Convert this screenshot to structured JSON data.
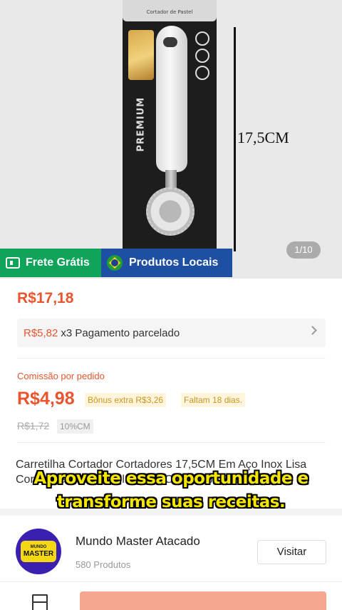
{
  "hero": {
    "package_label": "Cortador de Pastel",
    "brand_text": "PREMIUM",
    "dimension_label": "17,5CM",
    "pager": "1/10"
  },
  "badges": {
    "frete": "Frete Grátis",
    "local": "Produtos Locais"
  },
  "price": {
    "current": "R$17,18",
    "installment_amount": "R$5,82",
    "installment_text": "x3 Pagamento parcelado"
  },
  "commission": {
    "label": "Comissão por pedido",
    "value": "R$4,98",
    "bonus": "Bônus extra R$3,26",
    "remaining": "Faltam 18 dias.",
    "old_value": "R$1,72",
    "percent": "10%CM"
  },
  "product": {
    "title": "Carretilha Cortador Cortadores 17,5CM Em Aço Inox Lisa Cortar Massas Pastel Pizzas Com Cabo Branco"
  },
  "subtitle": {
    "line1": "Aproveite essa oportunidade e",
    "line2": "transforme suas receitas."
  },
  "store": {
    "logo_line1": "MUNDO",
    "logo_line2": "MASTER",
    "name": "Mundo Master Atacado",
    "count": "580 Produtos",
    "visit": "Visitar"
  },
  "colors": {
    "accent": "#e8552e",
    "frete_green": "#10a35a",
    "local_blue": "#1f4fa3",
    "subtitle_yellow": "#f5e600",
    "store_purple": "#3b1fb0"
  },
  "icons": [
    "truck-icon",
    "brazil-flag-icon",
    "chevron-right-icon",
    "store-icon"
  ]
}
